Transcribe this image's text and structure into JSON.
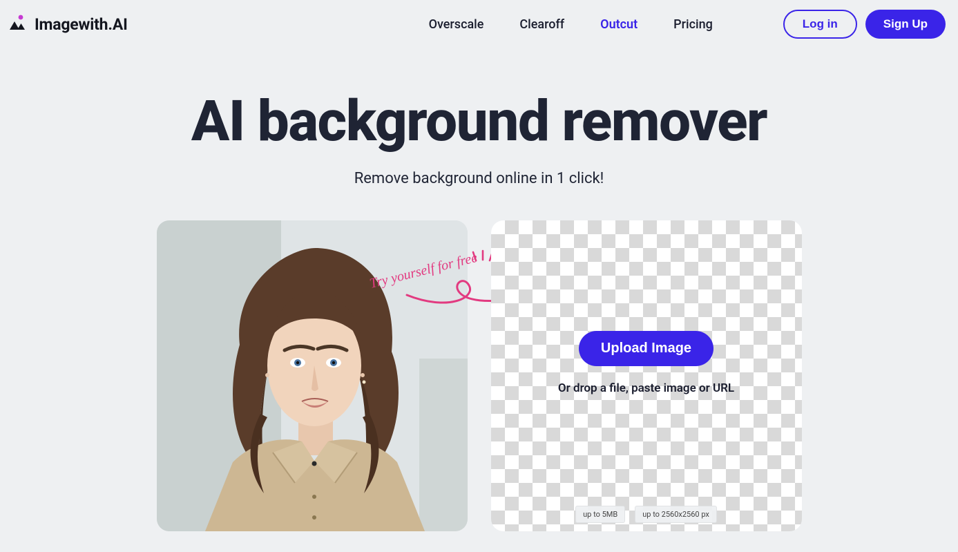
{
  "brand": "Imagewith.AI",
  "nav": {
    "items": [
      "Overscale",
      "Clearoff",
      "Outcut",
      "Pricing"
    ],
    "activeIndex": 2
  },
  "auth": {
    "login": "Log in",
    "signup": "Sign Up"
  },
  "hero": {
    "title": "AI background remover",
    "subtitle": "Remove background online in 1 click!"
  },
  "cta": {
    "try_label": "Try yourself for free",
    "upload": "Upload Image",
    "drop_hint": "Or drop a file, paste image or URL",
    "limits": [
      "up to 5MB",
      "up to 2560x2560 px"
    ]
  },
  "colors": {
    "accent": "#3a24e8",
    "bg": "#eef0f2",
    "handwriting": "#e23a80"
  }
}
